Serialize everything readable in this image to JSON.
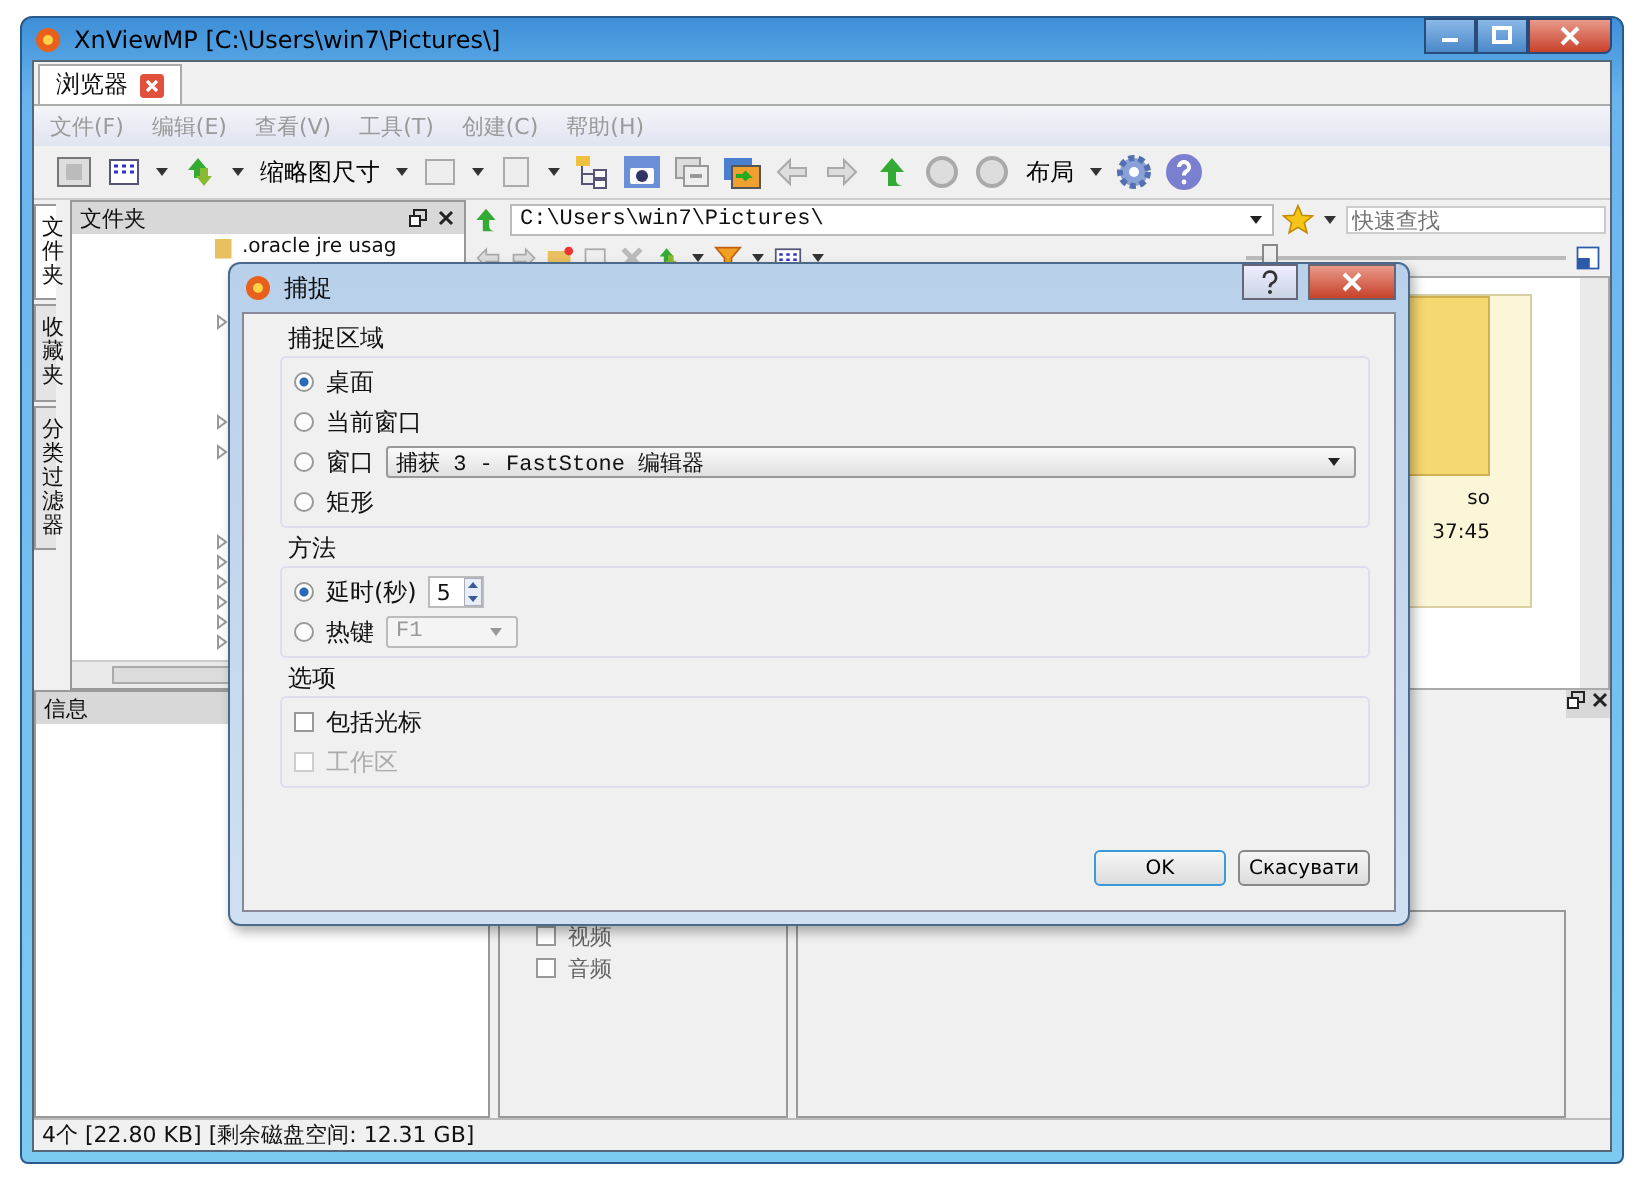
{
  "window": {
    "title": "XnViewMP [C:\\Users\\win7\\Pictures\\]"
  },
  "tabs": [
    {
      "label": "浏览器",
      "selected": true
    }
  ],
  "menu": {
    "disabled": true,
    "items": [
      "文件(F)",
      "编辑(E)",
      "查看(V)",
      "工具(T)",
      "创建(C)",
      "帮助(H)"
    ]
  },
  "toolbar": {
    "thumbnail_size": "缩略图尺寸",
    "layout": "布局"
  },
  "side_tabs": [
    {
      "label": "文件夹",
      "selected": true
    },
    {
      "label": "收藏夹",
      "selected": false
    },
    {
      "label": "分类过滤器",
      "selected": false
    }
  ],
  "folder_panel": {
    "title": "文件夹",
    "item": ".oracle jre usag"
  },
  "address": {
    "path": "C:\\Users\\win7\\Pictures\\",
    "search_placeholder": "快速查找"
  },
  "zoom_slider": {
    "level": 0.05
  },
  "thumbnail": {
    "caption": "so",
    "time": "37:45"
  },
  "info_panel": {
    "title": "信息"
  },
  "filters": [
    {
      "label": "视频",
      "checked": false
    },
    {
      "label": "音频",
      "checked": false
    }
  ],
  "status_bar": "4个 [22.80 KB] [剩余磁盘空间: 12.31 GB]",
  "dialog": {
    "title": "捕捉",
    "area": {
      "title": "捕捉区域",
      "options": [
        {
          "label": "桌面",
          "selected": true,
          "kind": "plain"
        },
        {
          "label": "当前窗口",
          "selected": false,
          "kind": "plain"
        },
        {
          "label": "窗口",
          "selected": false,
          "kind": "dropdown",
          "value": "捕获 3 - FastStone 编辑器",
          "disabled": false
        },
        {
          "label": "矩形",
          "selected": false,
          "kind": "plain"
        }
      ]
    },
    "method": {
      "title": "方法",
      "options": [
        {
          "label": "延时(秒)",
          "selected": true,
          "kind": "spinner",
          "value": "5"
        },
        {
          "label": "热键",
          "selected": false,
          "kind": "dropdown",
          "value": "F1",
          "disabled": true
        }
      ]
    },
    "extras": {
      "title": "选项",
      "checkboxes": [
        {
          "label": "包括光标",
          "checked": false,
          "disabled": false
        },
        {
          "label": "工作区",
          "checked": false,
          "disabled": true
        }
      ]
    },
    "buttons": [
      {
        "label": "OK",
        "kind": "default"
      },
      {
        "label": "Скасувати",
        "kind": "normal"
      }
    ]
  }
}
